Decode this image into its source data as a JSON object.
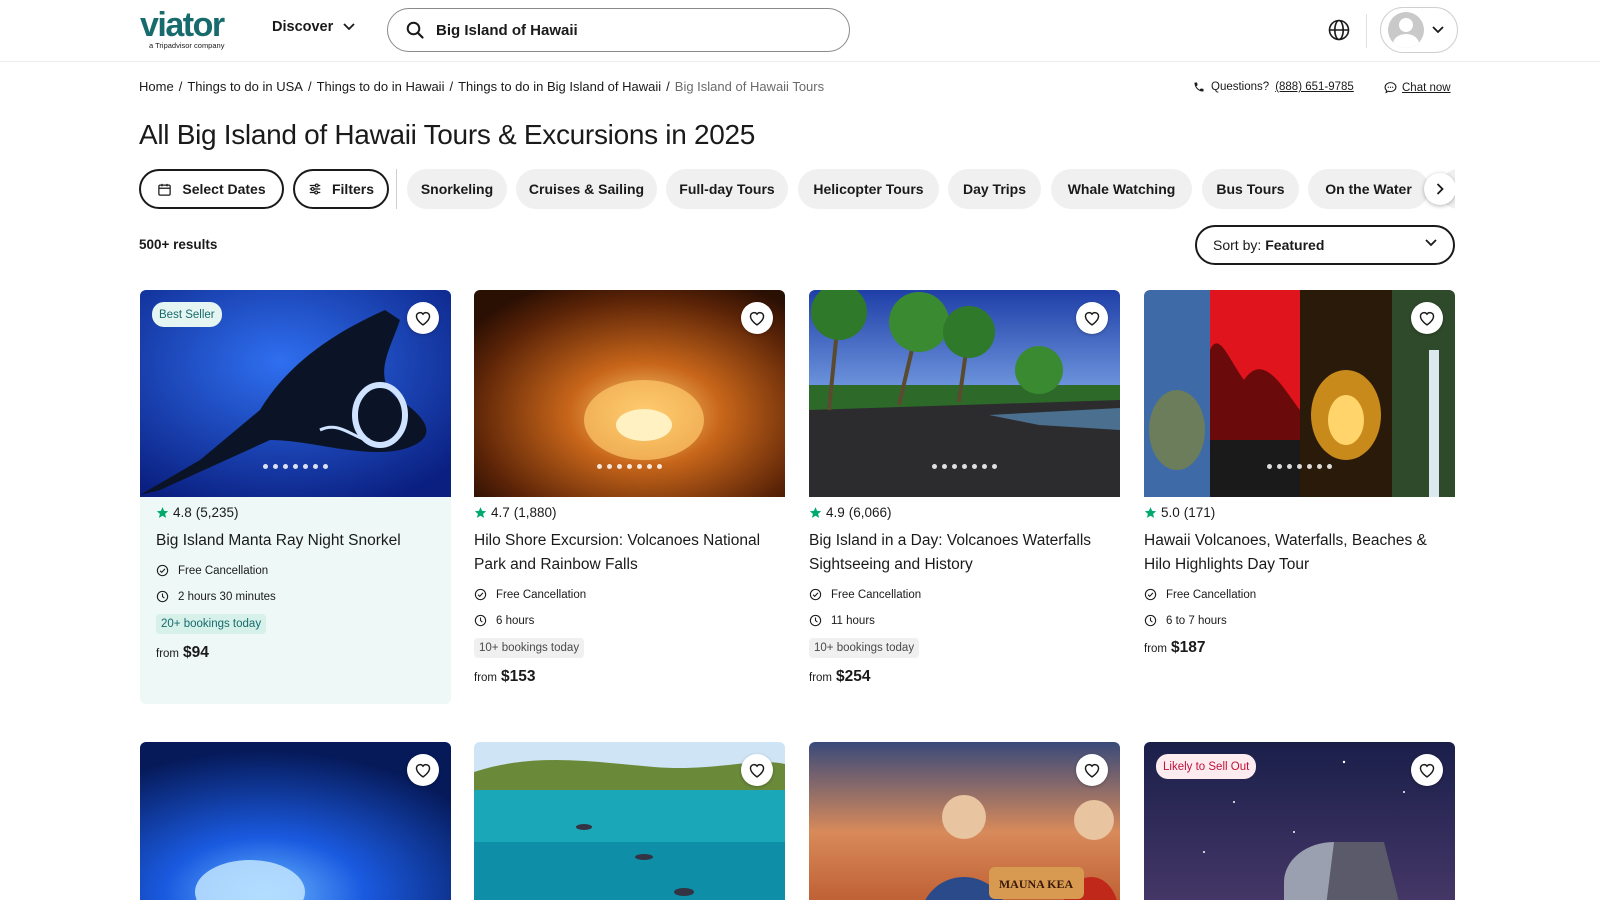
{
  "header": {
    "logo_text": "viator",
    "logo_sub": "a Tripadvisor company",
    "discover_label": "Discover",
    "search_value": "Big Island of Hawaii"
  },
  "breadcrumb": {
    "items": [
      "Home",
      "Things to do in USA",
      "Things to do in Hawaii",
      "Things to do in Big Island of Hawaii"
    ],
    "current": "Big Island of Hawaii Tours"
  },
  "support": {
    "questions_label": "Questions?",
    "phone": "(888) 651-9785",
    "chat_label": "Chat now"
  },
  "page_title": "All Big Island of Hawaii Tours & Excursions in 2025",
  "filters": {
    "select_dates": "Select Dates",
    "filters_label": "Filters",
    "chips": [
      "Snorkeling",
      "Cruises & Sailing",
      "Full-day Tours",
      "Helicopter Tours",
      "Day Trips",
      "Whale Watching",
      "Bus Tours",
      "On the Water"
    ]
  },
  "results": {
    "count": "500+ results",
    "sort_label": "Sort by:",
    "sort_value": "Featured"
  },
  "products": [
    {
      "badge": "Best Seller",
      "rating": "4.8",
      "reviews": "(5,235)",
      "title": "Big Island Manta Ray Night Snorkel",
      "cancellation": "Free Cancellation",
      "duration": "2 hours 30 minutes",
      "bookings": "20+ bookings today",
      "price_prefix": "from",
      "price": "$94"
    },
    {
      "rating": "4.7",
      "reviews": "(1,880)",
      "title": "Hilo Shore Excursion: Volcanoes National Park and Rainbow Falls",
      "cancellation": "Free Cancellation",
      "duration": "6 hours",
      "bookings": "10+ bookings today",
      "price_prefix": "from",
      "price": "$153"
    },
    {
      "rating": "4.9",
      "reviews": "(6,066)",
      "title": "Big Island in a Day: Volcanoes Waterfalls Sightseeing and History",
      "cancellation": "Free Cancellation",
      "duration": "11 hours",
      "bookings": "10+ bookings today",
      "price_prefix": "from",
      "price": "$254"
    },
    {
      "rating": "5.0",
      "reviews": "(171)",
      "title": "Hawaii Volcanoes, Waterfalls, Beaches & Hilo Highlights Day Tour",
      "cancellation": "Free Cancellation",
      "duration": "6 to 7 hours",
      "price_prefix": "from",
      "price": "$187"
    }
  ],
  "products_row2": [
    {
      "badge": ""
    },
    {
      "badge": ""
    },
    {
      "badge": "",
      "sign_text": "MAUNA KEA"
    },
    {
      "badge": "Likely to Sell Out"
    }
  ],
  "colors": {
    "brand": "#186b6d",
    "star": "#00aa6c",
    "sellout": "#c0123c"
  }
}
